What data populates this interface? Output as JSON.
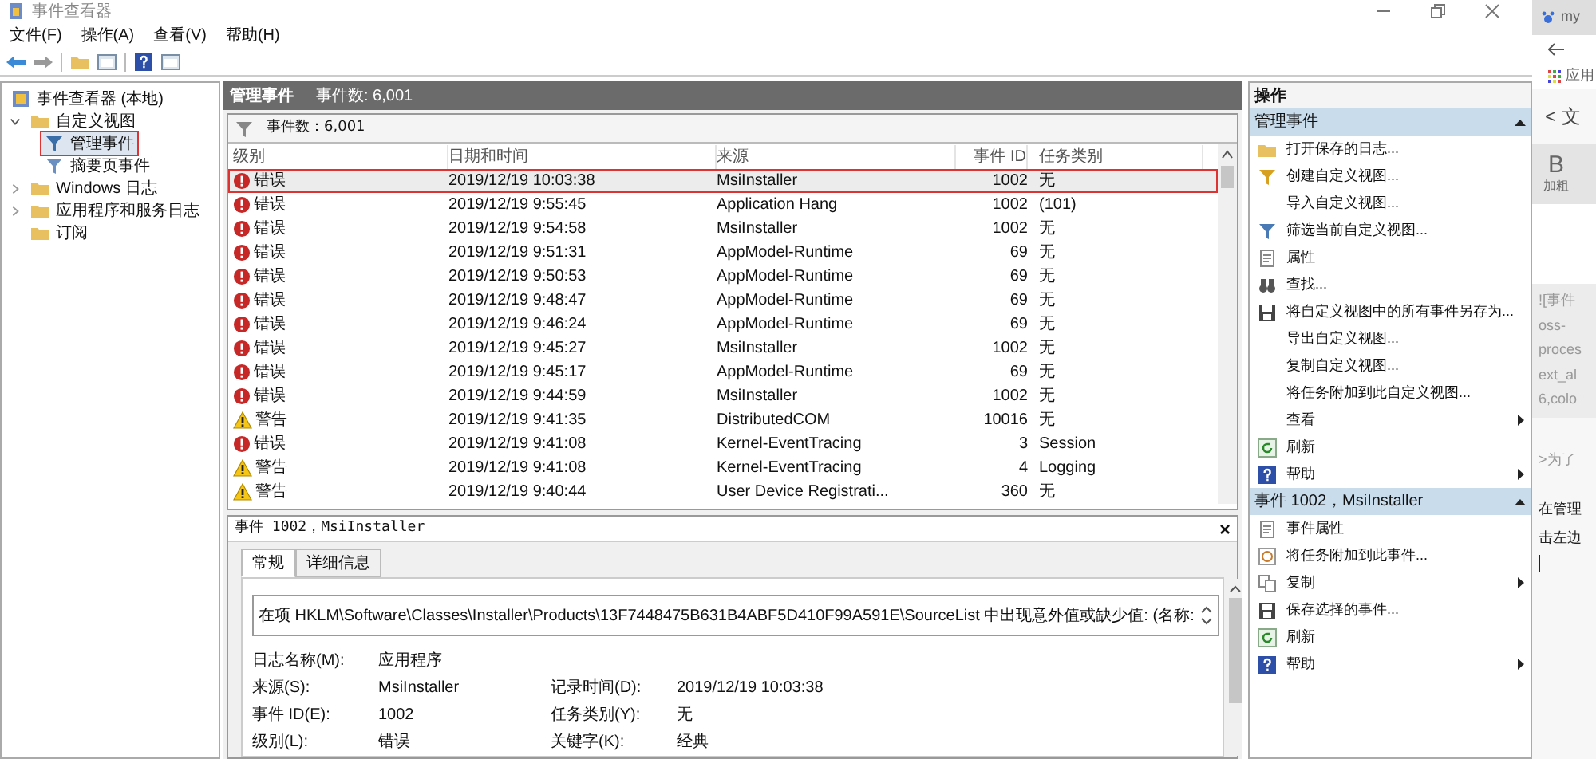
{
  "window": {
    "title": "事件查看器"
  },
  "menu": [
    "文件(F)",
    "操作(A)",
    "查看(V)",
    "帮助(H)"
  ],
  "tree": [
    {
      "label": "事件查看器 (本地)",
      "marked": false,
      "children": [
        {
          "label": "自定义视图",
          "expanded": true,
          "marked": false,
          "children": [
            {
              "label": "管理事件",
              "selected": true,
              "marked": true
            },
            {
              "label": "摘要页事件",
              "selected": false,
              "marked": false
            }
          ]
        },
        {
          "label": "Windows 日志",
          "expanded": false,
          "marked": false
        },
        {
          "label": "应用程序和服务日志",
          "expanded": false,
          "marked": false
        },
        {
          "label": "订阅",
          "marked": false
        }
      ]
    }
  ],
  "list_header": {
    "title": "管理事件",
    "count": "事件数: 6,001"
  },
  "filter_bar": {
    "text": "事件数：6,001"
  },
  "table": {
    "columns": [
      "级别",
      "日期和时间",
      "来源",
      "事件 ID",
      "任务类别"
    ],
    "rows": [
      {
        "kind": "error",
        "level": "错误",
        "time": "2019/12/19 10:03:38",
        "source": "MsiInstaller",
        "id": "1002",
        "category": "无",
        "selected": true,
        "marked": true
      },
      {
        "kind": "error",
        "level": "错误",
        "time": "2019/12/19 9:55:45",
        "source": "Application Hang",
        "id": "1002",
        "category": "(101)",
        "selected": false,
        "marked": false
      },
      {
        "kind": "error",
        "level": "错误",
        "time": "2019/12/19 9:54:58",
        "source": "MsiInstaller",
        "id": "1002",
        "category": "无",
        "selected": false,
        "marked": false
      },
      {
        "kind": "error",
        "level": "错误",
        "time": "2019/12/19 9:51:31",
        "source": "AppModel-Runtime",
        "id": "69",
        "category": "无",
        "selected": false,
        "marked": false
      },
      {
        "kind": "error",
        "level": "错误",
        "time": "2019/12/19 9:50:53",
        "source": "AppModel-Runtime",
        "id": "69",
        "category": "无",
        "selected": false,
        "marked": false
      },
      {
        "kind": "error",
        "level": "错误",
        "time": "2019/12/19 9:48:47",
        "source": "AppModel-Runtime",
        "id": "69",
        "category": "无",
        "selected": false,
        "marked": false
      },
      {
        "kind": "error",
        "level": "错误",
        "time": "2019/12/19 9:46:24",
        "source": "AppModel-Runtime",
        "id": "69",
        "category": "无",
        "selected": false,
        "marked": false
      },
      {
        "kind": "error",
        "level": "错误",
        "time": "2019/12/19 9:45:27",
        "source": "MsiInstaller",
        "id": "1002",
        "category": "无",
        "selected": false,
        "marked": false
      },
      {
        "kind": "error",
        "level": "错误",
        "time": "2019/12/19 9:45:17",
        "source": "AppModel-Runtime",
        "id": "69",
        "category": "无",
        "selected": false,
        "marked": false
      },
      {
        "kind": "error",
        "level": "错误",
        "time": "2019/12/19 9:44:59",
        "source": "MsiInstaller",
        "id": "1002",
        "category": "无",
        "selected": false,
        "marked": false
      },
      {
        "kind": "warning",
        "level": "警告",
        "time": "2019/12/19 9:41:35",
        "source": "DistributedCOM",
        "id": "10016",
        "category": "无",
        "selected": false,
        "marked": false
      },
      {
        "kind": "error",
        "level": "错误",
        "time": "2019/12/19 9:41:08",
        "source": "Kernel-EventTracing",
        "id": "3",
        "category": "Session",
        "selected": false,
        "marked": false
      },
      {
        "kind": "warning",
        "level": "警告",
        "time": "2019/12/19 9:41:08",
        "source": "Kernel-EventTracing",
        "id": "4",
        "category": "Logging",
        "selected": false,
        "marked": false
      },
      {
        "kind": "warning",
        "level": "警告",
        "time": "2019/12/19 9:40:44",
        "source": "User Device Registrati...",
        "id": "360",
        "category": "无",
        "selected": false,
        "marked": false
      }
    ]
  },
  "details": {
    "title": "事件 1002，MsiInstaller",
    "close": "×",
    "tabs": [
      {
        "label": "常规",
        "selected": true
      },
      {
        "label": "详细信息",
        "selected": false
      }
    ],
    "message": "在项 HKLM\\Software\\Classes\\Installer\\Products\\13F7448475B631B4ABF5D410F99A591E\\SourceList 中出现意外值或缺少值: (名称:",
    "fields": [
      [
        {
          "label": "日志名称(M):",
          "value": "应用程序"
        }
      ],
      [
        {
          "label": "来源(S):",
          "value": "MsiInstaller"
        },
        {
          "label": "记录时间(D):",
          "value": "2019/12/19 10:03:38"
        }
      ],
      [
        {
          "label": "事件 ID(E):",
          "value": "1002"
        },
        {
          "label": "任务类别(Y):",
          "value": "无"
        }
      ],
      [
        {
          "label": "级别(L):",
          "value": "错误"
        },
        {
          "label": "关键字(K):",
          "value": "经典"
        }
      ]
    ]
  },
  "actions": {
    "title": "操作",
    "sections": [
      {
        "title": "管理事件",
        "expanded": true,
        "items": [
          {
            "label": "打开保存的日志...",
            "submenu": false
          },
          {
            "label": "创建自定义视图...",
            "submenu": false
          },
          {
            "label": "导入自定义视图...",
            "submenu": false
          },
          {
            "label": "筛选当前自定义视图...",
            "submenu": false
          },
          {
            "label": "属性",
            "submenu": false
          },
          {
            "label": "查找...",
            "submenu": false
          },
          {
            "label": "将自定义视图中的所有事件另存为...",
            "submenu": false
          },
          {
            "label": "导出自定义视图...",
            "submenu": false
          },
          {
            "label": "复制自定义视图...",
            "submenu": false
          },
          {
            "label": "将任务附加到此自定义视图...",
            "submenu": false
          },
          {
            "label": "查看",
            "submenu": true
          },
          {
            "label": "刷新",
            "submenu": false
          },
          {
            "label": "帮助",
            "submenu": true
          }
        ]
      },
      {
        "title": "事件 1002，MsiInstaller",
        "expanded": true,
        "items": [
          {
            "label": "事件属性",
            "submenu": false
          },
          {
            "label": "将任务附加到此事件...",
            "submenu": false
          },
          {
            "label": "复制",
            "submenu": true
          },
          {
            "label": "保存选择的事件...",
            "submenu": false
          },
          {
            "label": "刷新",
            "submenu": false
          },
          {
            "label": "帮助",
            "submenu": true
          }
        ]
      }
    ]
  },
  "browser": {
    "tab": "my",
    "bookmarks": "应用",
    "back_link": "< 文",
    "bold_button": "B",
    "bold_label": "加粗",
    "code_lines": [
      "![事件",
      "oss-",
      "proces",
      "ext_al",
      "6,colo"
    ],
    "lines": [
      ">为了",
      "在管理",
      "击左边"
    ]
  }
}
